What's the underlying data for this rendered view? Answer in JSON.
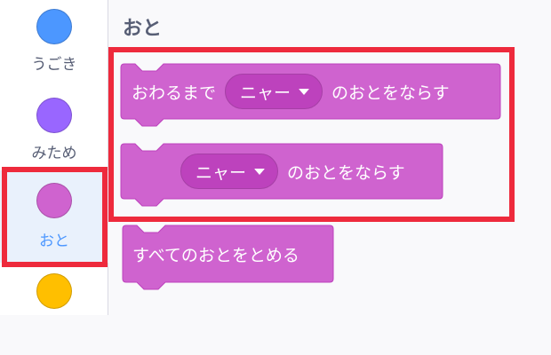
{
  "categories": [
    {
      "label": "うごき",
      "color": "#4c97ff"
    },
    {
      "label": "みため",
      "color": "#9966ff"
    },
    {
      "label": "おと",
      "color": "#cf63cf",
      "selected": true
    },
    {
      "label": "",
      "color": "#ffbf00"
    }
  ],
  "palette": {
    "section_title": "おと",
    "blocks": {
      "play_until_done": {
        "prefix": "おわるまで",
        "sound": "ニャー",
        "suffix": "のおとをならす"
      },
      "start_sound": {
        "sound": "ニャー",
        "suffix": "のおとをならす"
      },
      "stop_all_sounds": {
        "text": "すべてのおとをとめる"
      }
    }
  },
  "colors": {
    "sound_block": "#cf63cf",
    "sound_block_border": "#bd42bd",
    "dropdown_bg": "#bd42bd",
    "highlight": "#ee2a3c",
    "selected_category_bg": "#e9f1fc",
    "selected_category_text": "#4c97ff"
  }
}
